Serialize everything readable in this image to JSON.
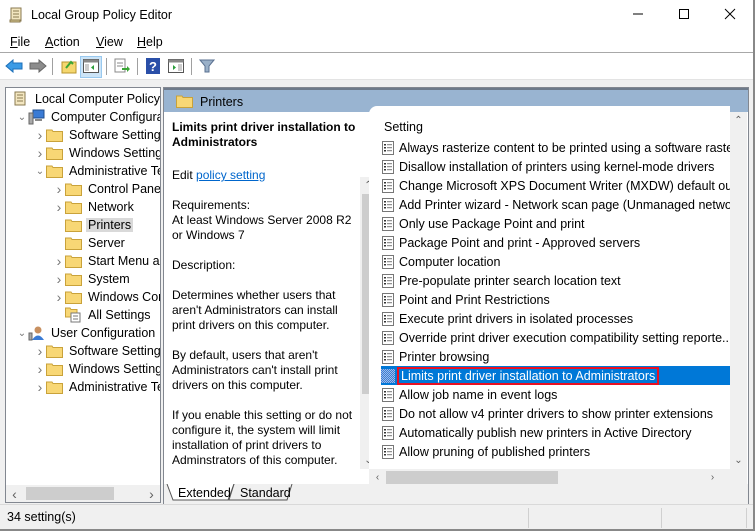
{
  "window": {
    "title": "Local Group Policy Editor",
    "controls": {
      "minimize": "minimize",
      "maximize": "maximize",
      "close": "close"
    }
  },
  "menu": {
    "items": [
      {
        "label": "File",
        "accel": "F",
        "rest": "ile"
      },
      {
        "label": "Action",
        "accel": "A",
        "rest": "ction"
      },
      {
        "label": "View",
        "accel": "V",
        "rest": "iew"
      },
      {
        "label": "Help",
        "accel": "H",
        "rest": "elp"
      }
    ]
  },
  "toolbar": {
    "buttons": [
      "back-icon",
      "forward-icon",
      "up-folder-icon",
      "show-hide-console-tree-icon",
      "export-list-icon",
      "help-icon",
      "show-hide-action-pane-icon",
      "filter-icon"
    ]
  },
  "tree": {
    "items": [
      {
        "label": "Local Computer Policy",
        "level": 0,
        "expander": "",
        "icon": "policy-scroll-icon"
      },
      {
        "label": "Computer Configura",
        "level": 1,
        "expander": "expanded",
        "icon": "computer-icon"
      },
      {
        "label": "Software Settings",
        "level": 2,
        "expander": "collapsed",
        "icon": "folder-icon"
      },
      {
        "label": "Windows Setting",
        "level": 2,
        "expander": "collapsed",
        "icon": "folder-icon"
      },
      {
        "label": "Administrative Te",
        "level": 2,
        "expander": "expanded",
        "icon": "folder-icon"
      },
      {
        "label": "Control Panel",
        "level": 3,
        "expander": "collapsed",
        "icon": "folder-icon"
      },
      {
        "label": "Network",
        "level": 3,
        "expander": "collapsed",
        "icon": "folder-icon"
      },
      {
        "label": "Printers",
        "level": 3,
        "expander": "",
        "icon": "folder-icon",
        "selected": true
      },
      {
        "label": "Server",
        "level": 3,
        "expander": "",
        "icon": "folder-icon"
      },
      {
        "label": "Start Menu ar",
        "level": 3,
        "expander": "collapsed",
        "icon": "folder-icon"
      },
      {
        "label": "System",
        "level": 3,
        "expander": "collapsed",
        "icon": "folder-icon"
      },
      {
        "label": "Windows Cor",
        "level": 3,
        "expander": "collapsed",
        "icon": "folder-icon"
      },
      {
        "label": "All Settings",
        "level": 3,
        "expander": "",
        "icon": "all-settings-icon"
      },
      {
        "label": "User Configuration",
        "level": 1,
        "expander": "expanded",
        "icon": "user-icon"
      },
      {
        "label": "Software Settings",
        "level": 2,
        "expander": "collapsed",
        "icon": "folder-icon"
      },
      {
        "label": "Windows Setting",
        "level": 2,
        "expander": "collapsed",
        "icon": "folder-icon"
      },
      {
        "label": "Administrative Te",
        "level": 2,
        "expander": "collapsed",
        "icon": "folder-icon"
      }
    ]
  },
  "details": {
    "header": "Printers",
    "extended": {
      "title": "Limits print driver installation to Administrators",
      "edit_prefix": "Edit",
      "edit_link": "policy setting",
      "requirements_label": "Requirements:",
      "requirements": "At least Windows Server 2008 R2 or Windows 7",
      "description_label": "Description:",
      "description_p1": "Determines whether users that aren't Administrators can install print drivers on this computer.",
      "description_p2": "By default, users that aren't Administrators can't install print drivers on this computer.",
      "description_p3": "If you enable this setting or do not configure it, the system will limit installation of print drivers to Adminstrators of this computer."
    },
    "list": {
      "column_header": "Setting",
      "rows": [
        "Always rasterize content to be printed using a software raste...",
        "Disallow installation of printers using kernel-mode drivers",
        "Change Microsoft XPS Document Writer (MXDW) default ou...",
        "Add Printer wizard - Network scan page (Unmanaged netwo...",
        "Only use Package Point and print",
        "Package Point and print - Approved servers",
        "Computer location",
        "Pre-populate printer search location text",
        "Point and Print Restrictions",
        "Execute print drivers in isolated processes",
        "Override print driver execution compatibility setting reporte...",
        "Printer browsing",
        "Limits print driver installation to Administrators",
        "Allow job name in event logs",
        "Do not allow v4 printer drivers to show printer extensions",
        "Automatically publish new printers in Active Directory",
        "Allow pruning of published printers"
      ],
      "selected_index": 12
    },
    "tabs": [
      "Extended",
      "Standard"
    ],
    "active_tab": "Extended"
  },
  "status": {
    "text": "34 setting(s)"
  },
  "colors": {
    "selection": "#0078d7",
    "highlight_box": "#e81123",
    "header_band": "#99b4d1",
    "link": "#0066cc"
  }
}
